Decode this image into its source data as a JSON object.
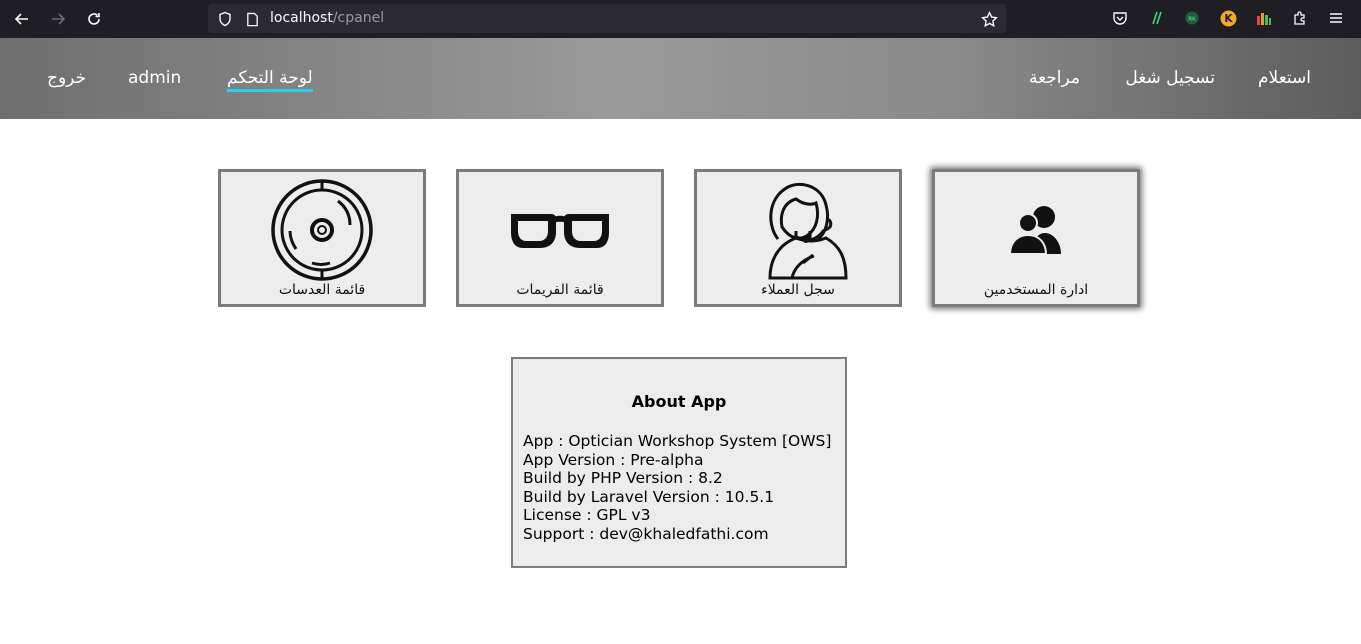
{
  "browser": {
    "url_host": "localhost",
    "url_path": "/cpanel"
  },
  "header": {
    "nav_right": [
      {
        "label": "استعلام"
      },
      {
        "label": "تسجيل شغل"
      },
      {
        "label": "مراجعة"
      }
    ],
    "nav_left": [
      {
        "label": "لوحة التحكم",
        "active": true
      },
      {
        "label": "admin"
      },
      {
        "label": "خروج"
      }
    ],
    "active_underline_color": "#22d3ee"
  },
  "cards": [
    {
      "label": "ادارة المستخدمين",
      "icon": "users-icon"
    },
    {
      "label": "سجل العملاء",
      "icon": "customer-support-icon"
    },
    {
      "label": "قائمة الفريمات",
      "icon": "glasses-icon"
    },
    {
      "label": "قائمة العدسات",
      "icon": "lens-icon"
    }
  ],
  "about": {
    "title": "About App",
    "lines": [
      "App : Optician Workshop System [OWS]",
      "App Version : Pre-alpha",
      "Build by PHP Version : 8.2",
      "Build by Laravel Version : 10.5.1",
      "License : GPL v3",
      "Support : dev@khaledfathi.com"
    ]
  }
}
